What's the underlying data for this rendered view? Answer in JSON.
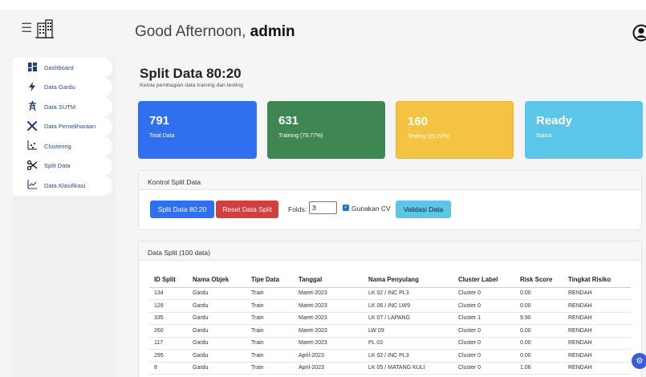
{
  "header": {
    "greeting_prefix": "Good Afternoon, ",
    "greeting_name": "admin",
    "menu_icon": "hamburger-icon",
    "logo_icon": "building-logo-icon",
    "user_icon": "user-circle-icon"
  },
  "sidebar": {
    "items": [
      {
        "label": "Dashboard",
        "icon": "dashboard-grid-icon"
      },
      {
        "label": "Data Gardu",
        "icon": "lightning-bolt-icon"
      },
      {
        "label": "Data SUTM",
        "icon": "transmission-tower-icon"
      },
      {
        "label": "Data Pemeliharaan",
        "icon": "tools-icon"
      },
      {
        "label": "Clustering",
        "icon": "scatter-icon"
      },
      {
        "label": "Split Data",
        "icon": "scissors-icon"
      },
      {
        "label": "Data Klasifikasi",
        "icon": "line-chart-icon"
      }
    ]
  },
  "page": {
    "title": "Split Data 80:20",
    "subtitle": "Kelola pembagian data training dan testing"
  },
  "stats": [
    {
      "value": "791",
      "label": "Total Data",
      "color": "#2f6ff0"
    },
    {
      "value": "631",
      "label": "Training (79.77%)",
      "color": "#3e8753"
    },
    {
      "value": "160",
      "label": "Testing (20.23%)",
      "color": "#f5c344"
    },
    {
      "value": "Ready",
      "label": "Status",
      "color": "#5cc6e8"
    }
  ],
  "control": {
    "title": "Kontrol Split Data",
    "split_button": "Split Data 80:20",
    "reset_button": "Reset Data Split",
    "folds_label": "Folds:",
    "folds_value": "3",
    "cv_label": "Gunakan CV",
    "cv_checked": true,
    "validate_button": "Validasi Data"
  },
  "table": {
    "title": "Data Split (100 data)",
    "columns": [
      "ID Split",
      "Nama Objek",
      "Tipe Data",
      "Tanggal",
      "Nama Penyulang",
      "Cluster Label",
      "Risk Score",
      "Tingkat Risiko"
    ],
    "rows": [
      [
        "134",
        "Gardu",
        "Train",
        "Maret-2023",
        "LK 02 / INC PL3",
        "Cluster 0",
        "0.00",
        "RENDAH"
      ],
      [
        "129",
        "Gardu",
        "Train",
        "Maret-2023",
        "LK 06 / INC LW9",
        "Cluster 0",
        "0.00",
        "RENDAH"
      ],
      [
        "335",
        "Gardu",
        "Train",
        "Maret-2023",
        "LK 07 / LAPANG",
        "Cluster 1",
        "9.90",
        "RENDAH"
      ],
      [
        "260",
        "Gardu",
        "Train",
        "Maret-2023",
        "LW 09",
        "Cluster 0",
        "0.00",
        "RENDAH"
      ],
      [
        "117",
        "Gardu",
        "Train",
        "Maret-2023",
        "PL 03",
        "Cluster 0",
        "0.00",
        "RENDAH"
      ],
      [
        "295",
        "Gardu",
        "Train",
        "April-2023",
        "LK 02 / INC PL3",
        "Cluster 0",
        "0.00",
        "RENDAH"
      ],
      [
        "8",
        "Gardu",
        "Train",
        "April-2023",
        "LK 05 / MATANG KULI",
        "Cluster 0",
        "1.06",
        "RENDAH"
      ]
    ]
  },
  "settings_icon": "gear-icon"
}
